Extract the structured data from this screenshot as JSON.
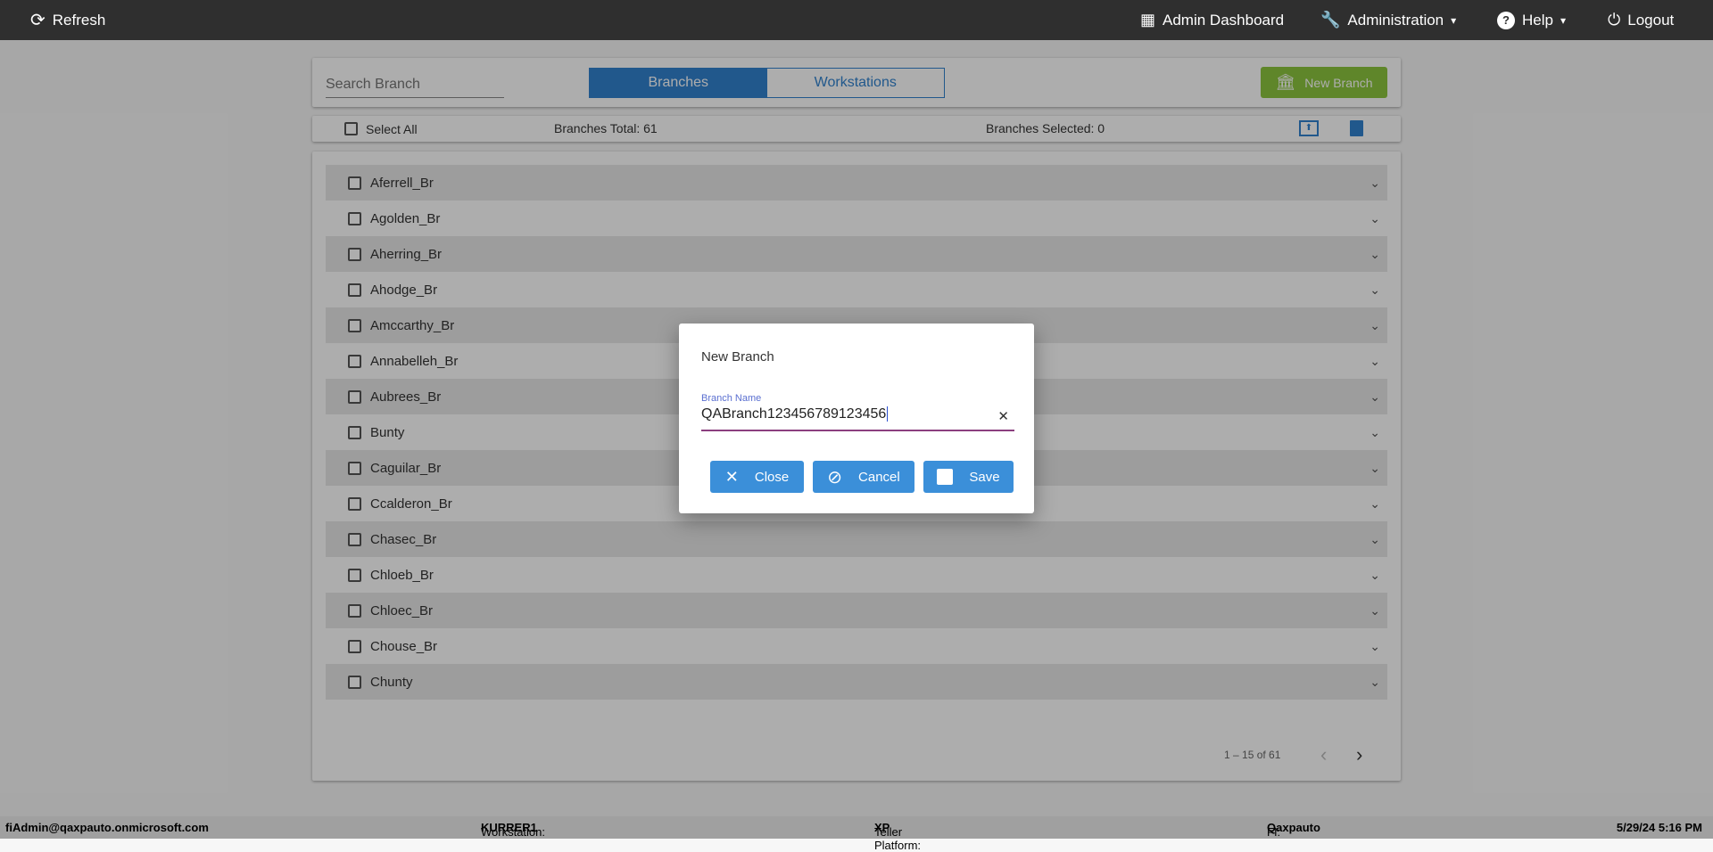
{
  "topbar": {
    "refresh": "Refresh",
    "admin_dashboard": "Admin Dashboard",
    "administration": "Administration",
    "help": "Help",
    "logout": "Logout"
  },
  "header": {
    "search_placeholder": "Search Branch",
    "tabs": [
      {
        "label": "Branches",
        "active": true
      },
      {
        "label": "Workstations",
        "active": false
      }
    ],
    "new_branch": "New Branch"
  },
  "toolbar": {
    "select_all": "Select All",
    "total": "Branches Total: 61",
    "selected": "Branches Selected: 0"
  },
  "branches": [
    "Aferrell_Br",
    "Agolden_Br",
    "Aherring_Br",
    "Ahodge_Br",
    "Amccarthy_Br",
    "Annabelleh_Br",
    "Aubrees_Br",
    "Bunty",
    "Caguilar_Br",
    "Ccalderon_Br",
    "Chasec_Br",
    "Chloeb_Br",
    "Chloec_Br",
    "Chouse_Br",
    "Chunty"
  ],
  "pagination": {
    "range": "1 – 15 of 61"
  },
  "dialog": {
    "title": "New Branch",
    "field_label": "Branch Name",
    "field_value": "QABranch123456789123456",
    "close": "Close",
    "cancel": "Cancel",
    "save": "Save"
  },
  "footer": {
    "user": "fiAdmin@qaxpauto.onmicrosoft.com",
    "workstation_label": "Workstation: ",
    "workstation": "KURRER1",
    "platform_label": "Teller Platform: ",
    "platform": "XP",
    "fi_label": "FI: ",
    "fi": "Qaxpauto",
    "datetime": "5/29/24 5:16 PM"
  },
  "colors": {
    "accent": "#3182ce",
    "new_branch": "#8dc63f",
    "dialog_button": "#3b8fd9",
    "topbar": "#2f2f2f"
  }
}
